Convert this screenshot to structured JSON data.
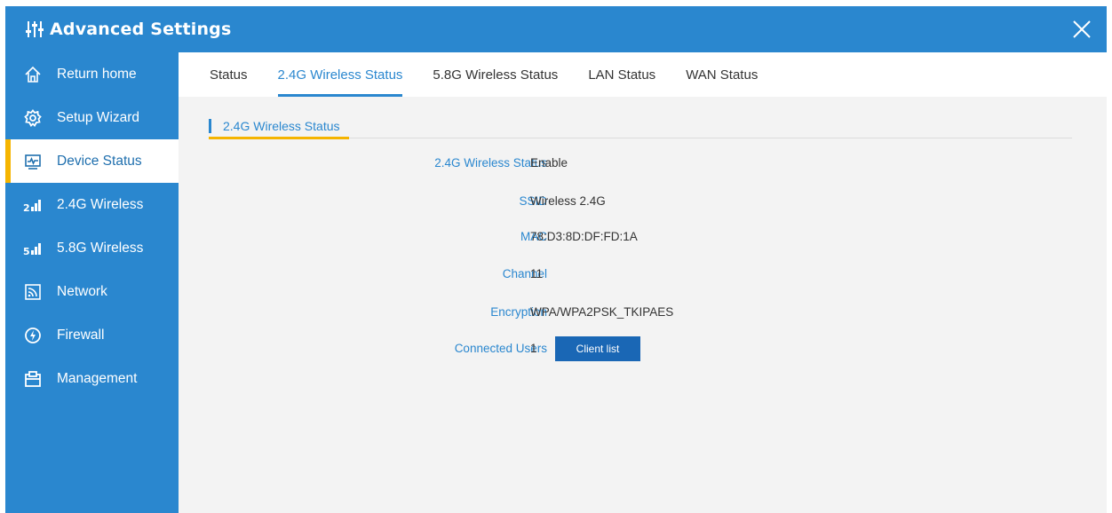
{
  "window": {
    "title": "Advanced Settings"
  },
  "sidebar": {
    "items": [
      {
        "label": "Return home",
        "icon": "home-icon"
      },
      {
        "label": "Setup Wizard",
        "icon": "gear-icon"
      },
      {
        "label": "Device Status",
        "icon": "monitor-icon",
        "active": true
      },
      {
        "label": "2.4G Wireless",
        "icon": "signal-2g-icon"
      },
      {
        "label": "5.8G Wireless",
        "icon": "signal-5g-icon"
      },
      {
        "label": "Network",
        "icon": "wifi-box-icon"
      },
      {
        "label": "Firewall",
        "icon": "shield-icon"
      },
      {
        "label": "Management",
        "icon": "clipboard-icon"
      }
    ]
  },
  "tabs": [
    {
      "label": "Status"
    },
    {
      "label": "2.4G Wireless Status",
      "active": true
    },
    {
      "label": "5.8G Wireless Status"
    },
    {
      "label": "LAN Status"
    },
    {
      "label": "WAN Status"
    }
  ],
  "section": {
    "title": "2.4G Wireless Status"
  },
  "fields": [
    {
      "key": "2.4G Wireless Status",
      "value": "Enable"
    },
    {
      "key": "SSID",
      "value": "Wireless 2.4G"
    },
    {
      "key": "MAC",
      "value": "78:D3:8D:DF:FD:1A"
    },
    {
      "key": "Channel",
      "value": "11"
    },
    {
      "key": "Encryption",
      "value": "WPA/WPA2PSK_TKIPAES"
    },
    {
      "key": "Connected Users",
      "value": "1"
    }
  ],
  "buttons": {
    "client_list": "Client list"
  },
  "colors": {
    "primary": "#2a87cf",
    "accent": "#f5b400",
    "button": "#1a67b5"
  }
}
